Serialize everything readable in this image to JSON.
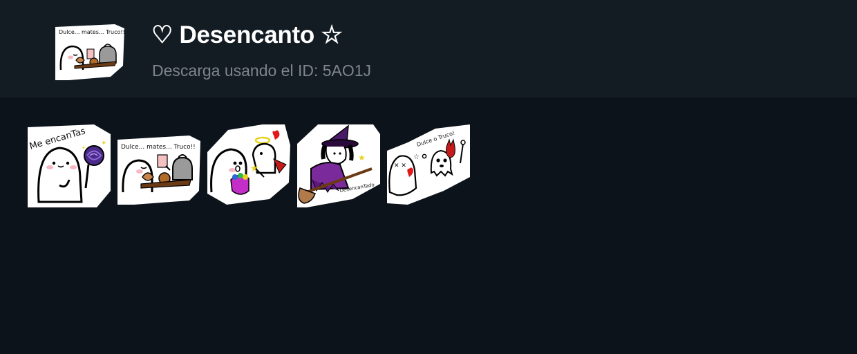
{
  "pack": {
    "title": "♡ Desencanto ☆",
    "subtitle": "Descarga usando el ID: 5AO1J",
    "cover_icon": "sticker-cover-dulce-mates-truco"
  },
  "stickers": [
    {
      "icon": "sticker-me-encantas-lollipop",
      "caption": "Me encanTas"
    },
    {
      "icon": "sticker-dulce-mates-truco",
      "caption": "Dulce... mates... Truco!!"
    },
    {
      "icon": "sticker-angel-candy-bag",
      "caption": ""
    },
    {
      "icon": "sticker-witch-broom",
      "caption": "DesencanTado"
    },
    {
      "icon": "sticker-ghosts-dulce-o-truco",
      "caption": "Dulce o Truco!"
    }
  ],
  "colors": {
    "page_background": "#0c131b",
    "header_background": "#131b23",
    "title_text": "#ffffff",
    "subtitle_text": "#7e858c"
  }
}
